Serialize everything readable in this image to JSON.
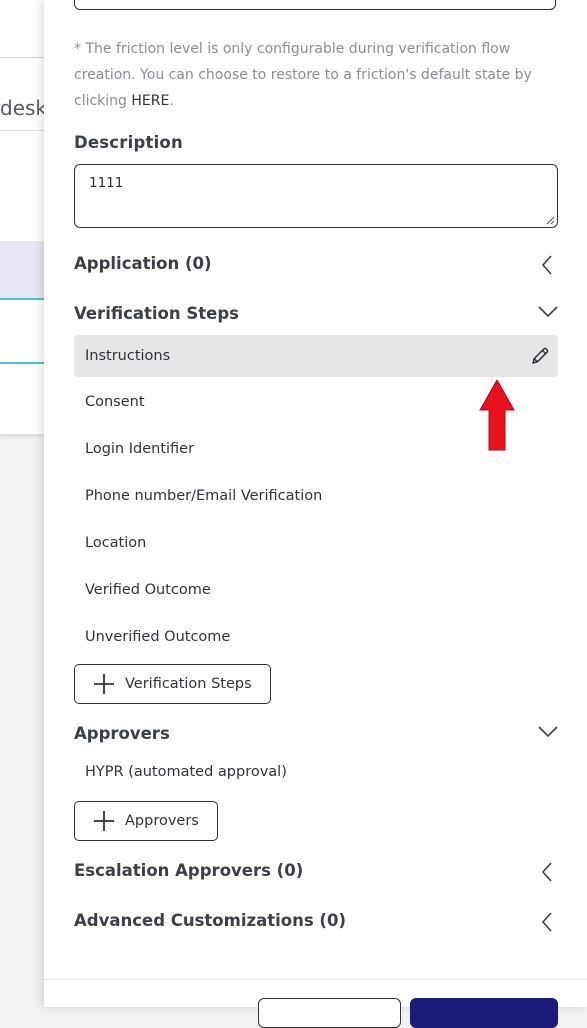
{
  "background": {
    "partial_text": "desk"
  },
  "note": {
    "text": "* The friction level is only configurable during verification flow creation. You can choose to restore to a friction's default state by clicking ",
    "link": "HERE",
    "suffix": "."
  },
  "description": {
    "label": "Description",
    "value": "1111"
  },
  "application": {
    "label": "Application (0)",
    "state": "collapsed"
  },
  "verification_steps": {
    "label": "Verification Steps",
    "state": "expanded",
    "items": [
      {
        "label": "Instructions",
        "selected": true
      },
      {
        "label": "Consent"
      },
      {
        "label": "Login Identifier"
      },
      {
        "label": "Phone number/Email Verification"
      },
      {
        "label": "Location"
      },
      {
        "label": "Verified Outcome"
      },
      {
        "label": "Unverified Outcome"
      }
    ],
    "add_label": "Verification Steps"
  },
  "approvers": {
    "label": "Approvers",
    "state": "expanded",
    "items": [
      "HYPR (automated approval)"
    ],
    "add_label": "Approvers"
  },
  "escalation_approvers": {
    "label": "Escalation Approvers (0)",
    "state": "collapsed"
  },
  "advanced_customizations": {
    "label": "Advanced Customizations (0)",
    "state": "collapsed"
  },
  "colors": {
    "accent": "#1c1a7a",
    "highlight_arrow": "#e8121f",
    "selected_row": "#e6e6e8",
    "background_cyan": "#44c4cf"
  }
}
